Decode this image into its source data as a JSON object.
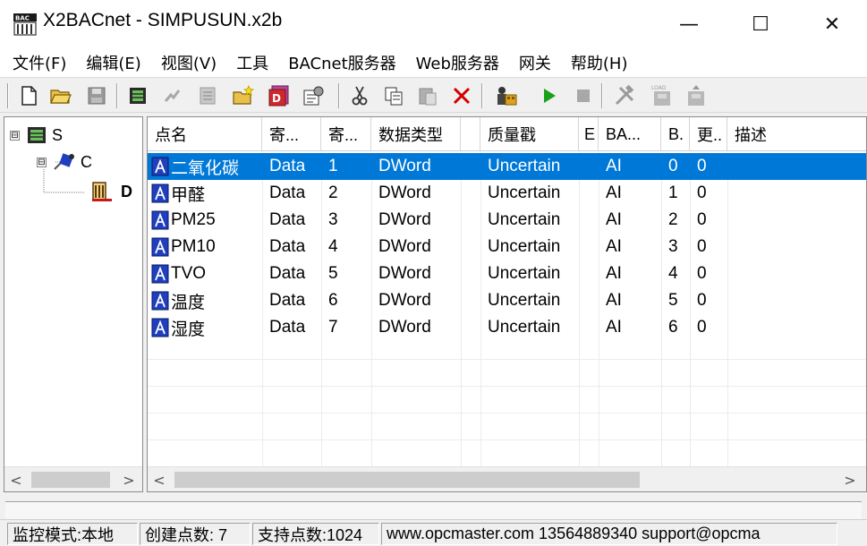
{
  "window": {
    "title": "X2BACnet - SIMPUSUN.x2b",
    "app_icon": "x2bacnet-app-icon",
    "controls": {
      "minimize": "—",
      "maximize": "☐",
      "close": "✕"
    }
  },
  "menu": [
    "文件(F)",
    "编辑(E)",
    "视图(V)",
    "工具",
    "BACnet服务器",
    "Web服务器",
    "网关",
    "帮助(H)"
  ],
  "toolbar": {
    "buttons": [
      "new-file",
      "open-folder",
      "save",
      "add-device",
      "add-group",
      "add-point",
      "new-item",
      "bacnet-device",
      "properties",
      "cut",
      "copy",
      "paste",
      "delete",
      "monitor-workers",
      "run",
      "stop",
      "tools",
      "load-config",
      "save-config"
    ]
  },
  "tree": {
    "root": {
      "label": "S",
      "icon": "server-icon",
      "expander": "⊟"
    },
    "channel": {
      "label": "C",
      "icon": "channel-icon",
      "expander": "⊟"
    },
    "device": {
      "label": "D",
      "icon": "device-icon"
    }
  },
  "list": {
    "columns": [
      "点名",
      "寄...",
      "寄...",
      "数据类型",
      "",
      "质量戳",
      "E",
      "BA...",
      "B.",
      "更..",
      "描述"
    ],
    "rows": [
      {
        "name": "二氧化碳",
        "c1": "Data",
        "c2": "1",
        "type": "DWord",
        "quality": "Uncertain",
        "ba": "AI",
        "b": "0",
        "upd": "0",
        "desc": "",
        "selected": true
      },
      {
        "name": "甲醛",
        "c1": "Data",
        "c2": "2",
        "type": "DWord",
        "quality": "Uncertain",
        "ba": "AI",
        "b": "1",
        "upd": "0",
        "desc": "",
        "selected": false
      },
      {
        "name": "PM25",
        "c1": "Data",
        "c2": "3",
        "type": "DWord",
        "quality": "Uncertain",
        "ba": "AI",
        "b": "2",
        "upd": "0",
        "desc": "",
        "selected": false
      },
      {
        "name": "PM10",
        "c1": "Data",
        "c2": "4",
        "type": "DWord",
        "quality": "Uncertain",
        "ba": "AI",
        "b": "3",
        "upd": "0",
        "desc": "",
        "selected": false
      },
      {
        "name": "TVO",
        "c1": "Data",
        "c2": "5",
        "type": "DWord",
        "quality": "Uncertain",
        "ba": "AI",
        "b": "4",
        "upd": "0",
        "desc": "",
        "selected": false
      },
      {
        "name": "温度",
        "c1": "Data",
        "c2": "6",
        "type": "DWord",
        "quality": "Uncertain",
        "ba": "AI",
        "b": "5",
        "upd": "0",
        "desc": "",
        "selected": false
      },
      {
        "name": "湿度",
        "c1": "Data",
        "c2": "7",
        "type": "DWord",
        "quality": "Uncertain",
        "ba": "AI",
        "b": "6",
        "upd": "0",
        "desc": "",
        "selected": false
      }
    ]
  },
  "scroll": {
    "left": "<",
    "right": ">"
  },
  "status": {
    "mode": "监控模式:本地",
    "created": "创建点数: 7",
    "supported": "支持点数:1024",
    "contact": "www.opcmaster.com 13564889340 support@opcma"
  },
  "colors": {
    "selection": "#0078d7",
    "point_icon": "#1f3fbf",
    "run": "#1aa01a",
    "delete": "#d40000"
  }
}
